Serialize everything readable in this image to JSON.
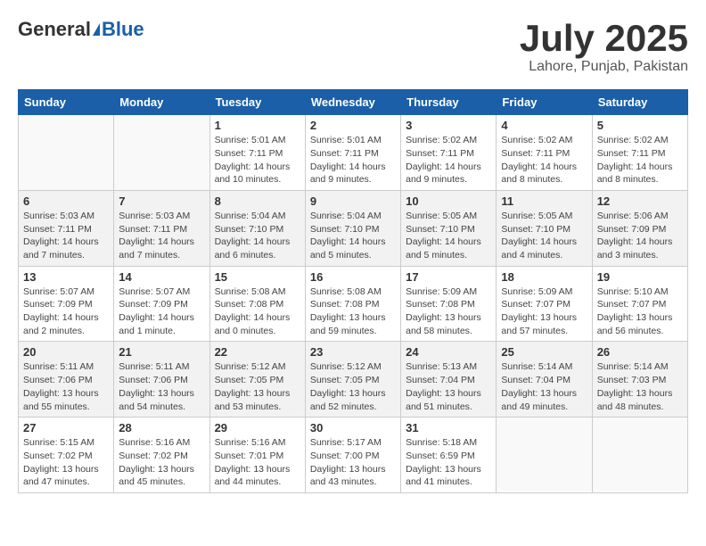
{
  "header": {
    "logo": {
      "part1": "General",
      "part2": "Blue"
    },
    "title": "July 2025",
    "location": "Lahore, Punjab, Pakistan"
  },
  "columns": [
    "Sunday",
    "Monday",
    "Tuesday",
    "Wednesday",
    "Thursday",
    "Friday",
    "Saturday"
  ],
  "weeks": [
    [
      {
        "day": "",
        "info": ""
      },
      {
        "day": "",
        "info": ""
      },
      {
        "day": "1",
        "info": "Sunrise: 5:01 AM\nSunset: 7:11 PM\nDaylight: 14 hours\nand 10 minutes."
      },
      {
        "day": "2",
        "info": "Sunrise: 5:01 AM\nSunset: 7:11 PM\nDaylight: 14 hours\nand 9 minutes."
      },
      {
        "day": "3",
        "info": "Sunrise: 5:02 AM\nSunset: 7:11 PM\nDaylight: 14 hours\nand 9 minutes."
      },
      {
        "day": "4",
        "info": "Sunrise: 5:02 AM\nSunset: 7:11 PM\nDaylight: 14 hours\nand 8 minutes."
      },
      {
        "day": "5",
        "info": "Sunrise: 5:02 AM\nSunset: 7:11 PM\nDaylight: 14 hours\nand 8 minutes."
      }
    ],
    [
      {
        "day": "6",
        "info": "Sunrise: 5:03 AM\nSunset: 7:11 PM\nDaylight: 14 hours\nand 7 minutes."
      },
      {
        "day": "7",
        "info": "Sunrise: 5:03 AM\nSunset: 7:11 PM\nDaylight: 14 hours\nand 7 minutes."
      },
      {
        "day": "8",
        "info": "Sunrise: 5:04 AM\nSunset: 7:10 PM\nDaylight: 14 hours\nand 6 minutes."
      },
      {
        "day": "9",
        "info": "Sunrise: 5:04 AM\nSunset: 7:10 PM\nDaylight: 14 hours\nand 5 minutes."
      },
      {
        "day": "10",
        "info": "Sunrise: 5:05 AM\nSunset: 7:10 PM\nDaylight: 14 hours\nand 5 minutes."
      },
      {
        "day": "11",
        "info": "Sunrise: 5:05 AM\nSunset: 7:10 PM\nDaylight: 14 hours\nand 4 minutes."
      },
      {
        "day": "12",
        "info": "Sunrise: 5:06 AM\nSunset: 7:09 PM\nDaylight: 14 hours\nand 3 minutes."
      }
    ],
    [
      {
        "day": "13",
        "info": "Sunrise: 5:07 AM\nSunset: 7:09 PM\nDaylight: 14 hours\nand 2 minutes."
      },
      {
        "day": "14",
        "info": "Sunrise: 5:07 AM\nSunset: 7:09 PM\nDaylight: 14 hours\nand 1 minute."
      },
      {
        "day": "15",
        "info": "Sunrise: 5:08 AM\nSunset: 7:08 PM\nDaylight: 14 hours\nand 0 minutes."
      },
      {
        "day": "16",
        "info": "Sunrise: 5:08 AM\nSunset: 7:08 PM\nDaylight: 13 hours\nand 59 minutes."
      },
      {
        "day": "17",
        "info": "Sunrise: 5:09 AM\nSunset: 7:08 PM\nDaylight: 13 hours\nand 58 minutes."
      },
      {
        "day": "18",
        "info": "Sunrise: 5:09 AM\nSunset: 7:07 PM\nDaylight: 13 hours\nand 57 minutes."
      },
      {
        "day": "19",
        "info": "Sunrise: 5:10 AM\nSunset: 7:07 PM\nDaylight: 13 hours\nand 56 minutes."
      }
    ],
    [
      {
        "day": "20",
        "info": "Sunrise: 5:11 AM\nSunset: 7:06 PM\nDaylight: 13 hours\nand 55 minutes."
      },
      {
        "day": "21",
        "info": "Sunrise: 5:11 AM\nSunset: 7:06 PM\nDaylight: 13 hours\nand 54 minutes."
      },
      {
        "day": "22",
        "info": "Sunrise: 5:12 AM\nSunset: 7:05 PM\nDaylight: 13 hours\nand 53 minutes."
      },
      {
        "day": "23",
        "info": "Sunrise: 5:12 AM\nSunset: 7:05 PM\nDaylight: 13 hours\nand 52 minutes."
      },
      {
        "day": "24",
        "info": "Sunrise: 5:13 AM\nSunset: 7:04 PM\nDaylight: 13 hours\nand 51 minutes."
      },
      {
        "day": "25",
        "info": "Sunrise: 5:14 AM\nSunset: 7:04 PM\nDaylight: 13 hours\nand 49 minutes."
      },
      {
        "day": "26",
        "info": "Sunrise: 5:14 AM\nSunset: 7:03 PM\nDaylight: 13 hours\nand 48 minutes."
      }
    ],
    [
      {
        "day": "27",
        "info": "Sunrise: 5:15 AM\nSunset: 7:02 PM\nDaylight: 13 hours\nand 47 minutes."
      },
      {
        "day": "28",
        "info": "Sunrise: 5:16 AM\nSunset: 7:02 PM\nDaylight: 13 hours\nand 45 minutes."
      },
      {
        "day": "29",
        "info": "Sunrise: 5:16 AM\nSunset: 7:01 PM\nDaylight: 13 hours\nand 44 minutes."
      },
      {
        "day": "30",
        "info": "Sunrise: 5:17 AM\nSunset: 7:00 PM\nDaylight: 13 hours\nand 43 minutes."
      },
      {
        "day": "31",
        "info": "Sunrise: 5:18 AM\nSunset: 6:59 PM\nDaylight: 13 hours\nand 41 minutes."
      },
      {
        "day": "",
        "info": ""
      },
      {
        "day": "",
        "info": ""
      }
    ]
  ]
}
